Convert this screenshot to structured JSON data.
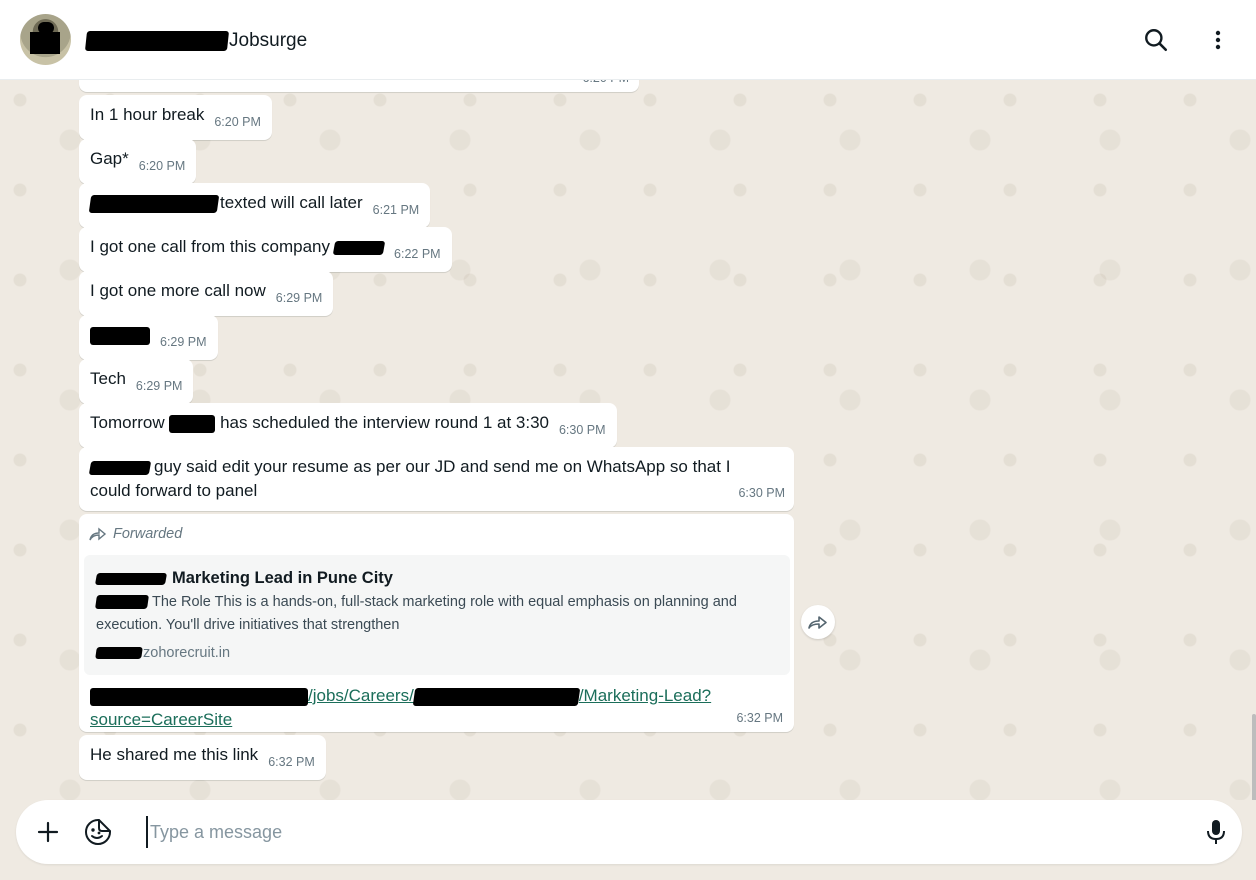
{
  "header": {
    "contact_name_suffix": "Jobsurge",
    "search_icon": "search-icon",
    "menu_icon": "kebab-menu-icon"
  },
  "messages": [
    {
      "text": "In 1 hour break",
      "time": "6:20 PM"
    },
    {
      "text": "Gap*",
      "time": "6:20 PM"
    },
    {
      "text": "texted will call later",
      "time": "6:21 PM"
    },
    {
      "text": "I got one call from this company",
      "time": "6:22 PM"
    },
    {
      "text": "I got one more call now",
      "time": "6:29 PM"
    },
    {
      "text": "",
      "time": "6:29 PM"
    },
    {
      "text": "Tech",
      "time": "6:29 PM"
    },
    {
      "text_before": "Tomorrow",
      "text_after": "has scheduled the interview round 1 at 3:30",
      "time": "6:30 PM"
    },
    {
      "text_line1": "guy said edit your resume as per our JD and send me on WhatsApp so that I",
      "text_line2": "could forward to panel",
      "time": "6:30 PM"
    },
    {
      "text": "He shared me this link",
      "time": "6:32 PM"
    }
  ],
  "forwarded": {
    "label": "Forwarded",
    "preview_title": "Marketing Lead in Pune City",
    "preview_desc_line1": "The Role This is a hands-on, full-stack marketing role with equal emphasis on planning and",
    "preview_desc_line2": "execution. You'll drive initiatives that strengthen",
    "preview_domain": "zohorecruit.in",
    "link_part1": "/jobs/Careers/",
    "link_part2": "/Marketing-Lead?",
    "link_part3": "source=CareerSite",
    "time": "6:32 PM"
  },
  "partial_top_time": "6:20 PM",
  "composer": {
    "placeholder": "Type a message",
    "value": ""
  },
  "colors": {
    "chat_bg": "#efeae2",
    "bubble_bg": "#ffffff",
    "time_gray": "#667781",
    "link_green": "#1b6e5a"
  }
}
